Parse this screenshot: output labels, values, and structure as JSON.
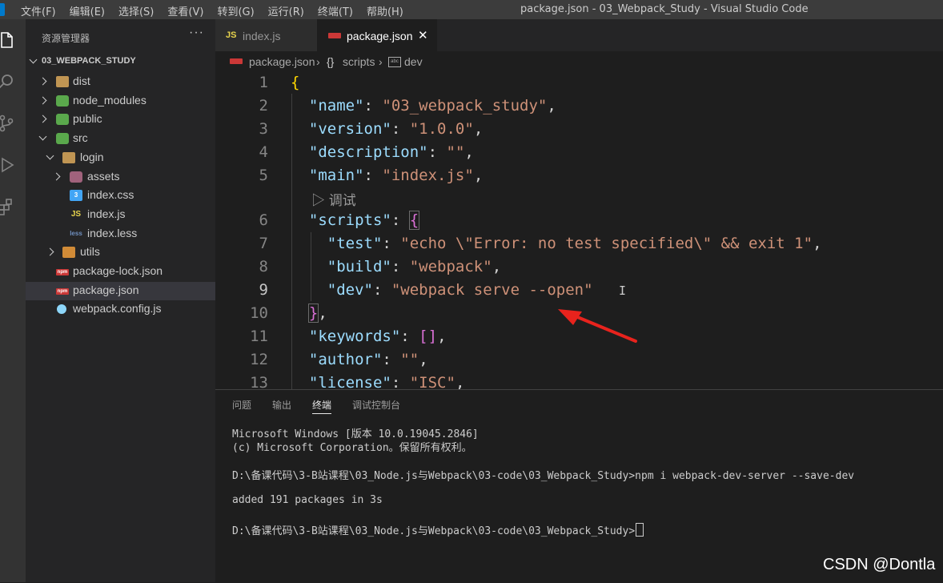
{
  "menu": [
    "文件(F)",
    "编辑(E)",
    "选择(S)",
    "查看(V)",
    "转到(G)",
    "运行(R)",
    "终端(T)",
    "帮助(H)"
  ],
  "window_title": "package.json - 03_Webpack_Study - Visual Studio Code",
  "activity_icons": [
    "explorer-icon",
    "search-icon",
    "source-control-icon",
    "run-debug-icon",
    "extensions-icon"
  ],
  "sidebar": {
    "header": "资源管理器",
    "more": "···",
    "project": "03_WEBPACK_STUDY",
    "items": [
      {
        "label": "dist",
        "icon": "folder-icon"
      },
      {
        "label": "node_modules",
        "icon": "node-folder-icon"
      },
      {
        "label": "public",
        "icon": "public-folder-icon"
      },
      {
        "label": "src",
        "icon": "src-folder-icon"
      },
      {
        "label": "login",
        "icon": "folder-open-icon"
      },
      {
        "label": "assets",
        "icon": "assets-folder-icon"
      },
      {
        "label": "index.css",
        "icon": "css-file-icon"
      },
      {
        "label": "index.js",
        "icon": "js-file-icon"
      },
      {
        "label": "index.less",
        "icon": "less-file-icon"
      },
      {
        "label": "utils",
        "icon": "utils-folder-icon"
      },
      {
        "label": "package-lock.json",
        "icon": "npm-file-icon"
      },
      {
        "label": "package.json",
        "icon": "npm-file-icon"
      },
      {
        "label": "webpack.config.js",
        "icon": "webpack-file-icon"
      }
    ],
    "selected": "package.json"
  },
  "tabs": [
    {
      "label": "index.js",
      "badge": "JS",
      "active": false
    },
    {
      "label": "package.json",
      "active": true,
      "close": "✕"
    }
  ],
  "breadcrumbs": {
    "file": "package.json",
    "sep": "›",
    "scripts": "scripts",
    "dev": "dev",
    "obj_glyph": "{}"
  },
  "editor": {
    "line_numbers": [
      "1",
      "2",
      "3",
      "4",
      "5",
      "6",
      "7",
      "8",
      "9",
      "10",
      "11",
      "12",
      "13"
    ],
    "active_line": "9",
    "codelens": "▷ 调试",
    "lines": {
      "l1": "{",
      "l2k": "\"name\"",
      "l2v": "\"03_webpack_study\"",
      "l3k": "\"version\"",
      "l3v": "\"1.0.0\"",
      "l4k": "\"description\"",
      "l4v": "\"\"",
      "l5k": "\"main\"",
      "l5v": "\"index.js\"",
      "l6k": "\"scripts\"",
      "l6b": "{",
      "l7k": "\"test\"",
      "l7v": "\"echo \\\"Error: no test specified\\\" && exit 1\"",
      "l8k": "\"build\"",
      "l8v": "\"webpack\"",
      "l9k": "\"dev\"",
      "l9v": "\"webpack serve --open\"",
      "l10": "}",
      "l11k": "\"keywords\"",
      "l11v": "[]",
      "l12k": "\"author\"",
      "l12v": "\"\"",
      "l13k": "\"license\"",
      "l13v": "\"ISC\""
    }
  },
  "panel": {
    "tabs": [
      "问题",
      "输出",
      "终端",
      "调试控制台"
    ],
    "active_tab": "终端",
    "terminal_lines": [
      "Microsoft Windows [版本 10.0.19045.2846]",
      "(c) Microsoft Corporation。保留所有权利。",
      "D:\\备课代码\\3-B站课程\\03_Node.js与Webpack\\03-code\\03_Webpack_Study>npm i webpack-dev-server --save-dev",
      "added 191 packages in 3s",
      "D:\\备课代码\\3-B站课程\\03_Node.js与Webpack\\03-code\\03_Webpack_Study>"
    ]
  },
  "watermark": "CSDN @Dontla",
  "colors": {
    "accent": "#007acc",
    "annotation_arrow": "#e8231d"
  }
}
